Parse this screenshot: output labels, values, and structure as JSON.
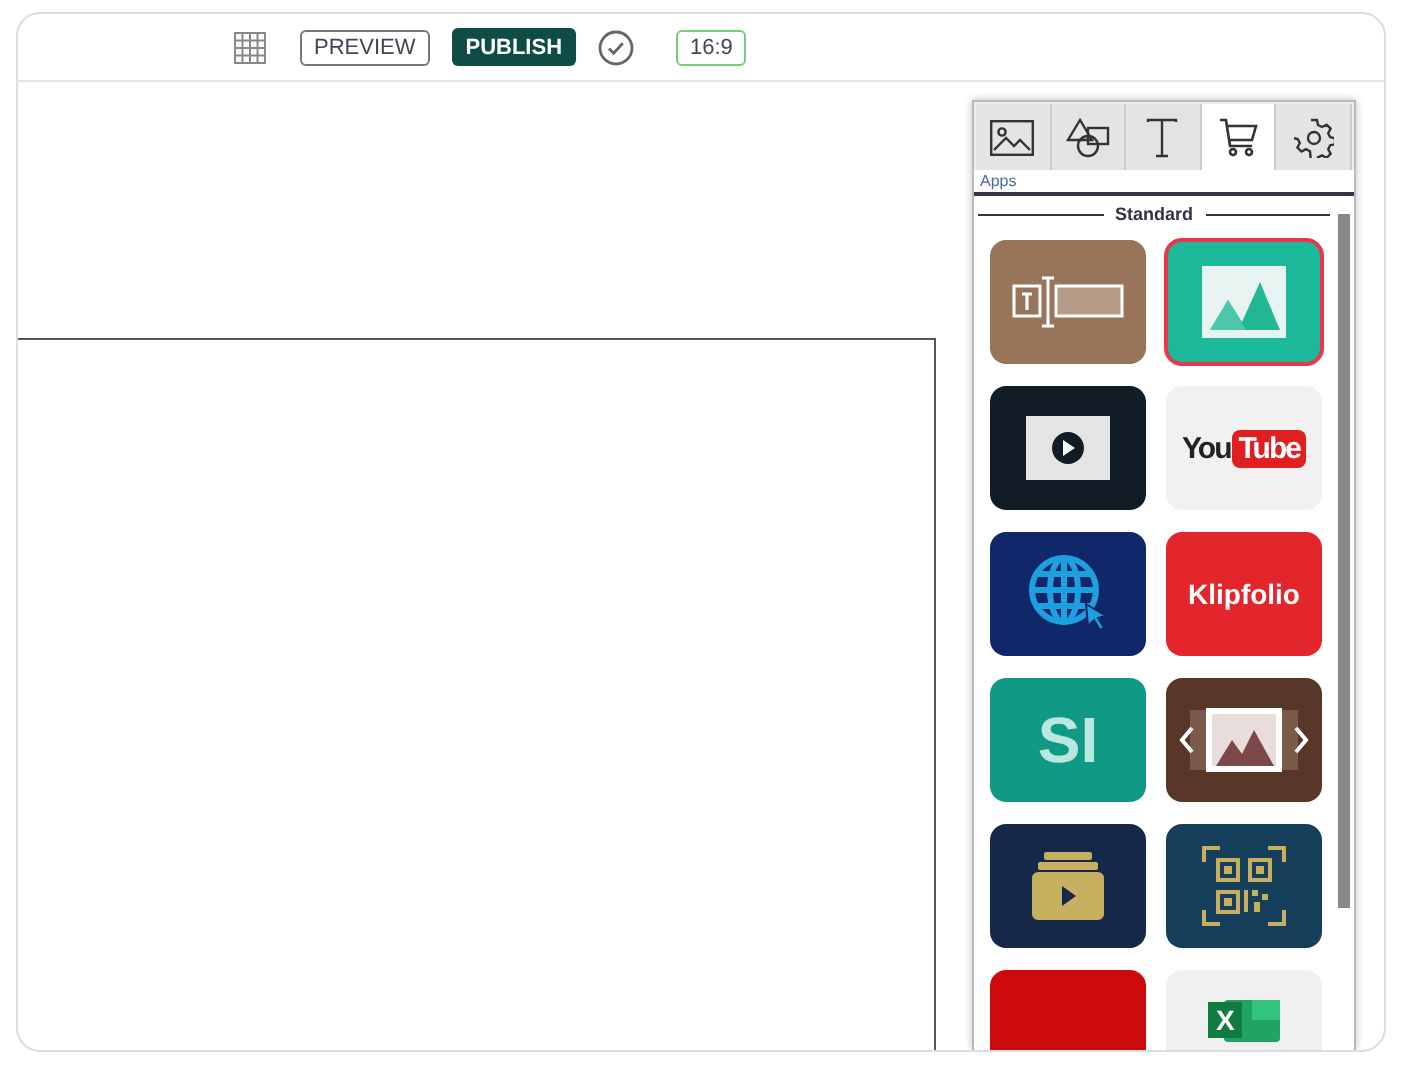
{
  "toolbar": {
    "preview": "PREVIEW",
    "publish": "PUBLISH",
    "aspect_ratio": "16:9"
  },
  "panel": {
    "tabs": [
      {
        "kind": "image",
        "selected": false
      },
      {
        "kind": "shapes",
        "selected": false
      },
      {
        "kind": "text",
        "selected": false
      },
      {
        "kind": "cart",
        "selected": true
      },
      {
        "kind": "settings",
        "selected": false
      }
    ],
    "caption": "Apps",
    "section": "Standard",
    "apps": [
      {
        "kind": "text-field",
        "selected": false
      },
      {
        "kind": "image",
        "selected": true
      },
      {
        "kind": "video",
        "selected": false
      },
      {
        "kind": "youtube",
        "selected": false,
        "texts": [
          "You",
          "Tube"
        ]
      },
      {
        "kind": "web",
        "selected": false
      },
      {
        "kind": "klipfolio",
        "selected": false,
        "texts": [
          "Klipfolio"
        ]
      },
      {
        "kind": "si",
        "selected": false,
        "texts": [
          "SI"
        ]
      },
      {
        "kind": "slideshow",
        "selected": false
      },
      {
        "kind": "playlist",
        "selected": false
      },
      {
        "kind": "qr",
        "selected": false
      },
      {
        "kind": "pdf",
        "selected": false
      },
      {
        "kind": "excel",
        "selected": false,
        "texts": [
          "X"
        ]
      }
    ]
  }
}
